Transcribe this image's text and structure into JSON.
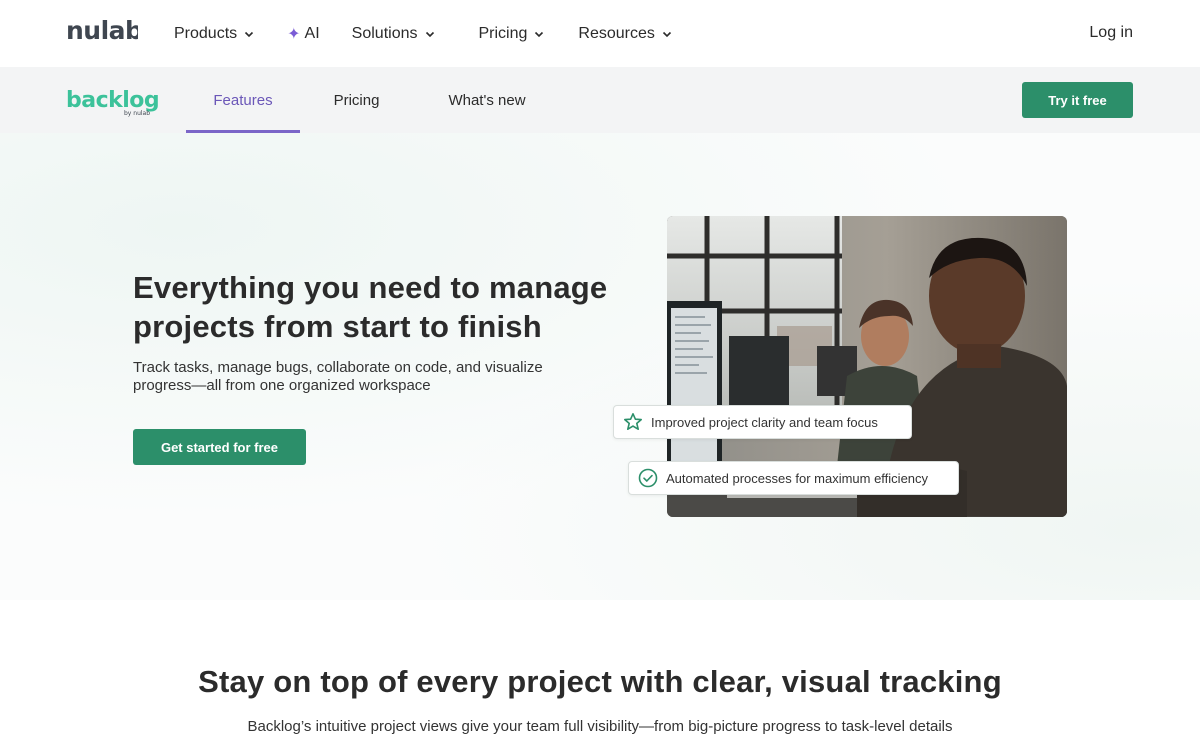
{
  "topnav": {
    "logo_text": "nulab",
    "items": [
      {
        "label": "Products"
      },
      {
        "label": "AI"
      },
      {
        "label": "Solutions"
      },
      {
        "label": "Pricing"
      },
      {
        "label": "Resources"
      }
    ],
    "login_label": "Log in"
  },
  "subnav": {
    "logo_text": "backlog",
    "logo_sub": "by nulab",
    "tabs": [
      {
        "label": "Features"
      },
      {
        "label": "Pricing"
      },
      {
        "label": "What's new"
      }
    ],
    "try_label": "Try it free"
  },
  "hero": {
    "title": "Everything you need to manage projects from start to finish",
    "subtitle": "Track tasks, manage bugs, collaborate on code, and visualize progress—all from one organized workspace",
    "cta_label": "Get started for free",
    "badges": [
      {
        "label": "Improved project clarity and team focus",
        "icon": "star-icon"
      },
      {
        "label": "Automated processes for maximum efficiency",
        "icon": "check-circle-icon"
      }
    ]
  },
  "section": {
    "title": "Stay on top of every project with clear, visual tracking",
    "subtitle": "Backlog’s intuitive project views give your team full visibility—from big-picture progress to task-level details"
  },
  "colors": {
    "brand_green": "#2c8f6a",
    "accent_purple": "#6b57b8",
    "ai_spark": "#7b5cd6"
  }
}
